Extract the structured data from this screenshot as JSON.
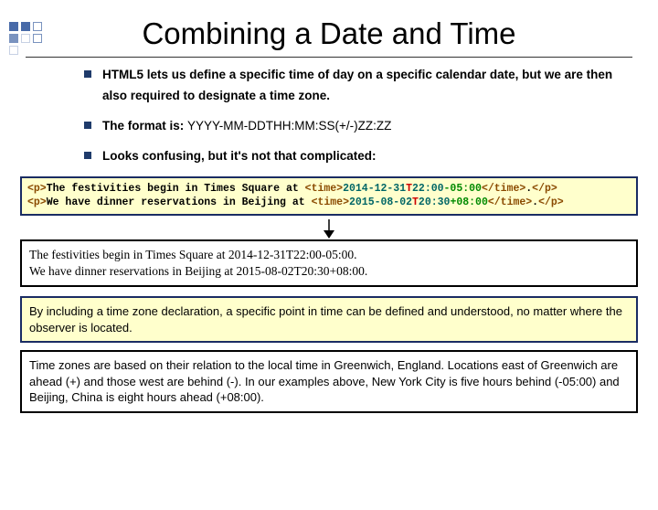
{
  "title": "Combining a Date and Time",
  "bullets": {
    "b1": "HTML5 lets us define a specific time of day on a specific calendar date, but we are then also required to designate a time zone.",
    "b2_a": "The format is: ",
    "b2_b": "YYYY-MM-DDTHH:MM:SS(+/-)ZZ:ZZ",
    "b3": "Looks confusing, but it's not that complicated:"
  },
  "code": {
    "l1": {
      "a": "<p>",
      "b": "The festivities begin in Times Square at ",
      "c": "<time>",
      "d": "2014-12-31",
      "e": "T",
      "f": "22:00",
      "g": "-05:00",
      "h": "</time>",
      "i": ".",
      "j": "</p>"
    },
    "l2": {
      "a": "<p>",
      "b": "We have dinner reservations in Beijing at ",
      "c": "<time>",
      "d": "2015-08-02",
      "e": "T",
      "f": "20:30",
      "g": "+08:00",
      "h": "</time>",
      "i": ".",
      "j": "</p>"
    }
  },
  "rendered": {
    "l1": "The festivities begin in Times Square at 2014-12-31T22:00-05:00.",
    "l2": "We have dinner reservations in Beijing at 2015-08-02T20:30+08:00."
  },
  "note": "By including a time zone declaration, a specific point in time can be defined and understood, no matter where the observer is located.",
  "plain": "Time zones are based on their relation to the local time in Greenwich, England.  Locations east of Greenwich are ahead (+) and those west are behind (-).  In our examples above, New York City is five hours behind (-05:00) and Beijing, China is eight hours ahead (+08:00)."
}
